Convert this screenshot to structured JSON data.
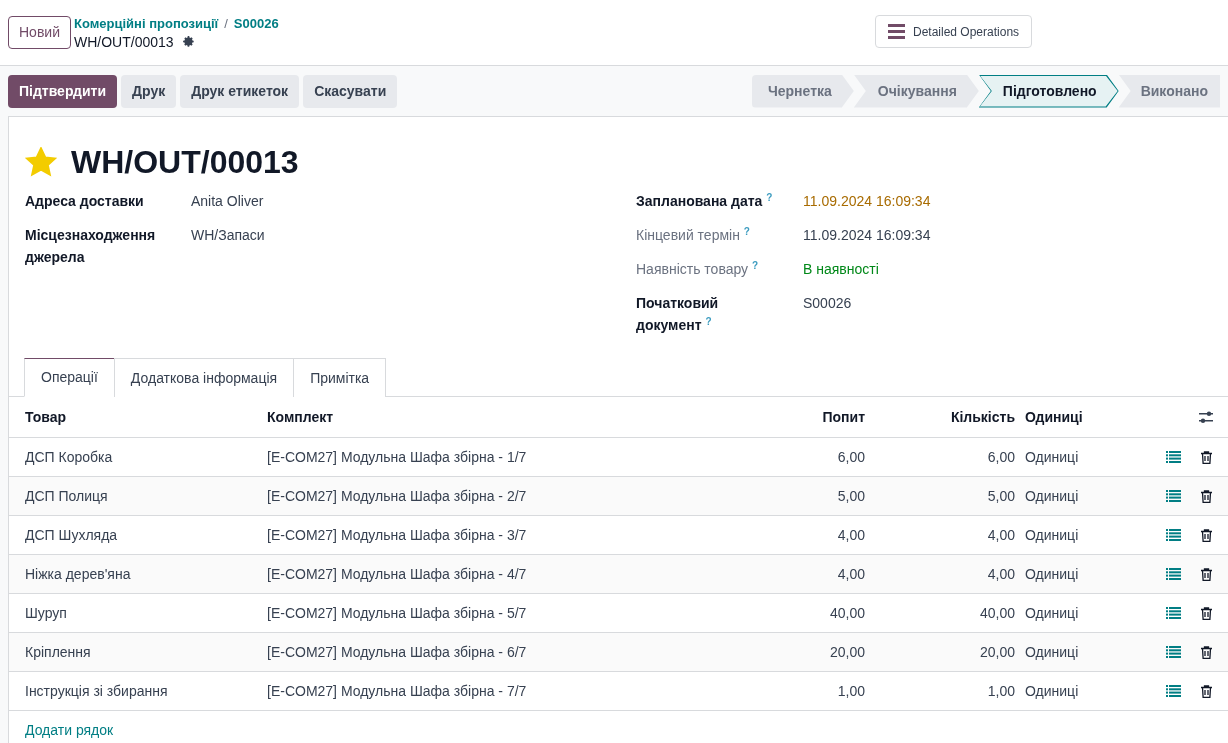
{
  "control_panel": {
    "new_button": "Новий",
    "breadcrumbs": [
      "Комерційні пропозиції",
      "S00026"
    ],
    "breadcrumb_separator": "/",
    "record_name": "WH/OUT/00013",
    "detailed_operations_button": "Detailed Operations"
  },
  "actions": [
    {
      "label": "Підтвердити",
      "kind": "primary"
    },
    {
      "label": "Друк",
      "kind": "secondary"
    },
    {
      "label": "Друк етикеток",
      "kind": "secondary"
    },
    {
      "label": "Скасувати",
      "kind": "secondary"
    }
  ],
  "statusbar": [
    {
      "label": "Чернетка",
      "selected": false
    },
    {
      "label": "Очікування",
      "selected": false
    },
    {
      "label": "Підготовлено",
      "selected": true
    },
    {
      "label": "Виконано",
      "selected": false
    }
  ],
  "form": {
    "starred": true,
    "title": "WH/OUT/00013",
    "left_fields": [
      {
        "label": "Адреса доставки",
        "value": "Anita Oliver",
        "required": true,
        "color": "#374151"
      },
      {
        "label": "Місцезнаходження джерела",
        "value": "WH/Запаси",
        "required": true,
        "color": "#374151"
      }
    ],
    "right_fields": [
      {
        "label": "Запланована дата",
        "help": "?",
        "value": "11.09.2024 16:09:34",
        "required": true,
        "color": "#a86b00"
      },
      {
        "label": "Кінцевий термін",
        "help": "?",
        "value": "11.09.2024 16:09:34",
        "required": false,
        "color": "#374151"
      },
      {
        "label": "Наявність товару",
        "help": "?",
        "value": "В наявності",
        "required": false,
        "color": "#008818"
      },
      {
        "label": "Початковий документ",
        "help": "?",
        "value": "S00026",
        "required": true,
        "color": "#374151"
      }
    ]
  },
  "tabs": [
    {
      "label": "Операції",
      "selected": true
    },
    {
      "label": "Додаткова інформація",
      "selected": false
    },
    {
      "label": "Примітка",
      "selected": false
    }
  ],
  "table": {
    "columns": [
      "Товар",
      "Комплект",
      "Попит",
      "Кількість",
      "Одиниці"
    ],
    "rows": [
      {
        "product": "ДСП Коробка",
        "kit": "[E-COM27] Модульна Шафа збірна - 1/7",
        "demand": "6,00",
        "quantity": "6,00",
        "unit": "Одиниці"
      },
      {
        "product": "ДСП Полиця",
        "kit": "[E-COM27] Модульна Шафа збірна - 2/7",
        "demand": "5,00",
        "quantity": "5,00",
        "unit": "Одиниці"
      },
      {
        "product": "ДСП Шухляда",
        "kit": "[E-COM27] Модульна Шафа збірна - 3/7",
        "demand": "4,00",
        "quantity": "4,00",
        "unit": "Одиниці"
      },
      {
        "product": "Ніжка дерев'яна",
        "kit": "[E-COM27] Модульна Шафа збірна - 4/7",
        "demand": "4,00",
        "quantity": "4,00",
        "unit": "Одиниці"
      },
      {
        "product": "Шуруп",
        "kit": "[E-COM27] Модульна Шафа збірна - 5/7",
        "demand": "40,00",
        "quantity": "40,00",
        "unit": "Одиниці"
      },
      {
        "product": "Кріплення",
        "kit": "[E-COM27] Модульна Шафа збірна - 6/7",
        "demand": "20,00",
        "quantity": "20,00",
        "unit": "Одиниці"
      },
      {
        "product": "Інструкція зі збирання",
        "kit": "[E-COM27] Модульна Шафа збірна - 7/7",
        "demand": "1,00",
        "quantity": "1,00",
        "unit": "Одиниці"
      }
    ],
    "add_line": "Додати рядок"
  }
}
